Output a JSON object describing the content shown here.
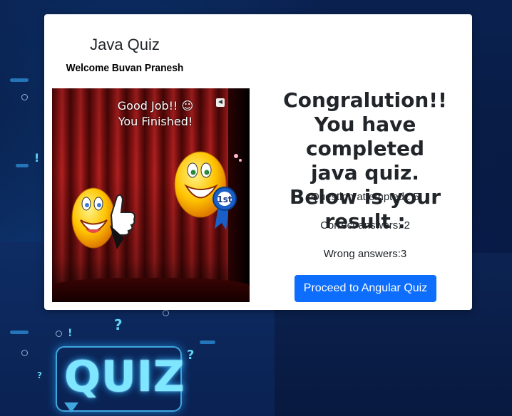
{
  "modal": {
    "title": "Java Quiz",
    "welcome": "Welcome Buvan Pranesh",
    "image": {
      "message_line1": "Good Job!! ☺",
      "message_line2": "You Finished!",
      "ribbon_text": "1st"
    },
    "result": {
      "heading_line1": "Congralution!!",
      "heading_line2": "You have completed",
      "heading_line3": "java quiz.",
      "heading_line4": "Below is your result :",
      "attempted": "Question attempted : 5",
      "correct": "Correct answers: 2",
      "wrong": "Wrong answers:3"
    },
    "proceed_button": "Proceed to Angular Quiz"
  },
  "background": {
    "badge_text": "QUIZ"
  },
  "colors": {
    "primary_button": "#0d6efd",
    "background": "#071a3c",
    "badge_glow": "#7fe6ff"
  }
}
